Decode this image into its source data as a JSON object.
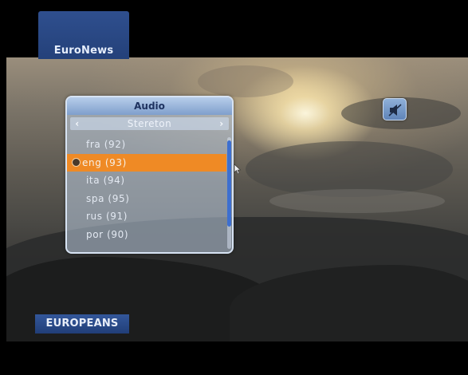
{
  "channel": {
    "name": "EuroNews"
  },
  "audio_menu": {
    "title": "Audio",
    "mode": "Stereton",
    "mode_prev": "‹",
    "mode_next": "›",
    "tracks": [
      {
        "label": "fra (92)",
        "selected": false
      },
      {
        "label": "eng (93)",
        "selected": true
      },
      {
        "label": "ita (94)",
        "selected": false
      },
      {
        "label": "spa (95)",
        "selected": false
      },
      {
        "label": "rus (91)",
        "selected": false
      },
      {
        "label": "por (90)",
        "selected": false
      }
    ],
    "selected_color": "#ef8a25"
  },
  "mute": {
    "icon": "mute-speaker-icon"
  },
  "program_logo": {
    "text": "EUROPEANS"
  }
}
